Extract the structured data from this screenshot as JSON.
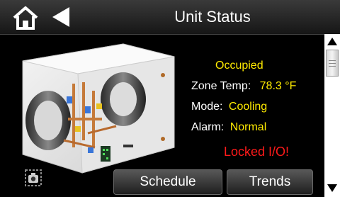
{
  "header": {
    "title": "Unit Status",
    "home_icon": "home-icon",
    "back_icon": "back-arrow-icon"
  },
  "status": {
    "occupancy": "Occupied",
    "zone_temp_label": "Zone Temp:",
    "zone_temp_value": "78.3 °F",
    "mode_label": "Mode:",
    "mode_value": "Cooling",
    "alarm_label": "Alarm:",
    "alarm_value": "Normal",
    "warning": "Locked I/O!"
  },
  "buttons": {
    "schedule": "Schedule",
    "trends": "Trends"
  },
  "icons": {
    "camera": "camera-icon"
  },
  "colors": {
    "value_yellow": "#ffeb00",
    "warning_red": "#ff1a1a",
    "text_white": "#ffffff",
    "background": "#000000"
  }
}
